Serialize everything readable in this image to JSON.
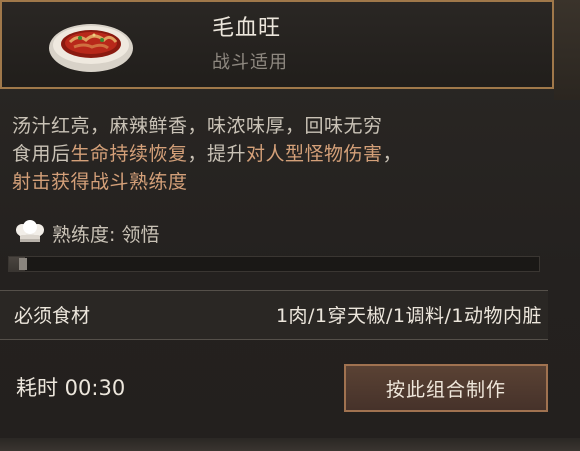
{
  "header": {
    "dish_name": "毛血旺",
    "dish_sub": "战斗适用"
  },
  "description": {
    "line1": "汤汁红亮，麻辣鲜香，味浓味厚，回味无穷",
    "part_a": "食用后",
    "part_b": "生命持续恢复",
    "part_c": "，提升",
    "part_d": "对人型怪物伤害",
    "part_e": "，",
    "part_f": "射击获得战斗熟练度"
  },
  "proficiency": {
    "label": "熟练度: 领悟",
    "progress": 0.03
  },
  "ingredients": {
    "label": "必须食材",
    "value": "1肉/1穿天椒/1调料/1动物内脏"
  },
  "time": {
    "label": "耗时 00:30"
  },
  "craft_button": {
    "label": "按此组合制作"
  },
  "colors": {
    "accent": "#a0784a",
    "highlight": "#d4a079"
  }
}
